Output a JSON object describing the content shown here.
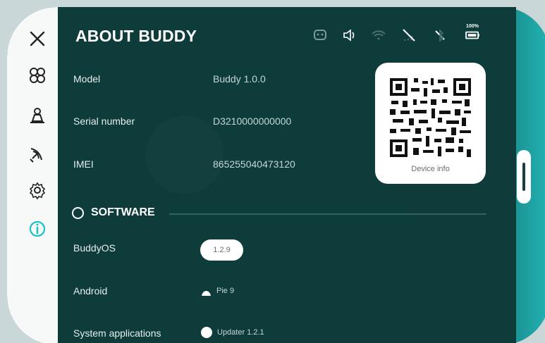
{
  "page": {
    "title": "ABOUT BUDDY"
  },
  "device_info": [
    {
      "label": "Model",
      "value": "Buddy 1.0.0"
    },
    {
      "label": "Serial number",
      "value": "D3210000000000"
    },
    {
      "label": "IMEI",
      "value": "865255040473120"
    }
  ],
  "qr": {
    "caption": "Device info"
  },
  "software": {
    "title": "SOFTWARE",
    "rows": [
      {
        "label": "BuddyOS",
        "value": "1.2.9"
      },
      {
        "label": "Android",
        "value": "Pie 9"
      },
      {
        "label": "System applications",
        "value": "Updater 1.2.1"
      }
    ]
  },
  "status": {
    "battery_text": "100%"
  },
  "sidebar": {
    "items": [
      {
        "icon": "close-icon"
      },
      {
        "icon": "apps-icon"
      },
      {
        "icon": "robot-icon"
      },
      {
        "icon": "satellite-icon"
      },
      {
        "icon": "settings-icon"
      },
      {
        "icon": "info-icon"
      }
    ],
    "active_color": "#18c2c7"
  }
}
